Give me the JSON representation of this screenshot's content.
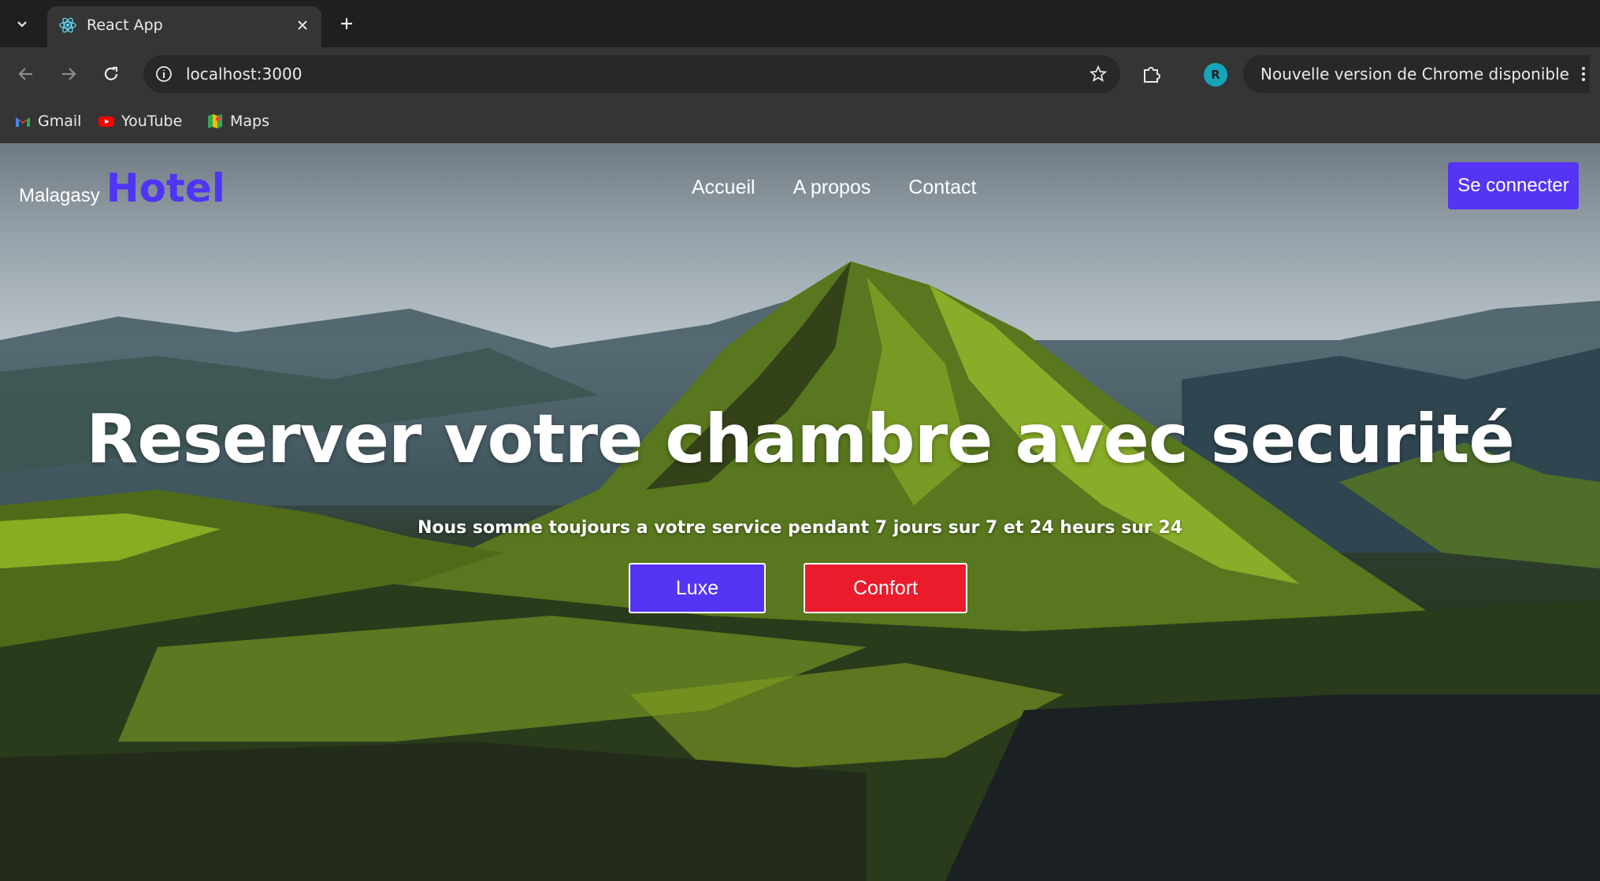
{
  "browser": {
    "tab_title": "React App",
    "url": "localhost:3000",
    "profile_initial": "R",
    "update_text": "Nouvelle version de Chrome disponible",
    "bookmarks": [
      {
        "label": "Gmail",
        "icon": "gmail-icon"
      },
      {
        "label": "YouTube",
        "icon": "youtube-icon"
      },
      {
        "label": "Maps",
        "icon": "maps-icon"
      }
    ]
  },
  "site": {
    "logo_small": "Malagasy",
    "logo_big": "Hotel",
    "nav": [
      "Accueil",
      "A propos",
      "Contact"
    ],
    "login_label": "Se connecter"
  },
  "hero": {
    "title": "Reserver votre chambre avec securité",
    "subtitle": "Nous somme toujours a votre service pendant 7 jours sur 7 et 24 heurs sur 24",
    "btn_luxe": "Luxe",
    "btn_confort": "Confort"
  },
  "colors": {
    "brand": "#4f35f3",
    "primary_button": "#5634f5",
    "danger_button": "#ea1c2c"
  }
}
